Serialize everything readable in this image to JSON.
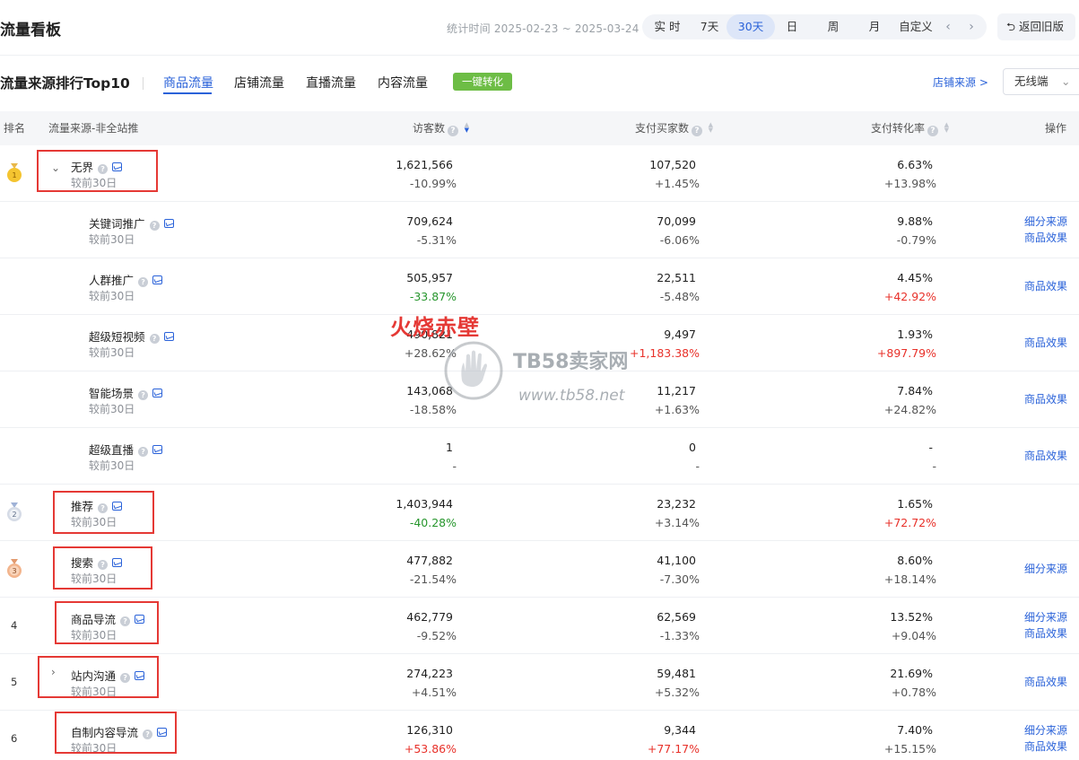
{
  "header": {
    "title": "流量看板",
    "stat_time": "统计时间 2025-02-23 ~ 2025-03-24",
    "periods": [
      "实 时",
      "7天",
      "30天",
      "日",
      "周",
      "月",
      "自定义"
    ],
    "active_period": "30天",
    "back_button": "返回旧版"
  },
  "section": {
    "title": "流量来源排行Top10",
    "tabs": [
      "商品流量",
      "店铺流量",
      "直播流量",
      "内容流量"
    ],
    "active_tab": "商品流量",
    "convert_button": "一键转化",
    "shop_source_link": "店铺来源 >",
    "device_select": "无线端"
  },
  "table": {
    "columns": {
      "rank": "排名",
      "source": "流量来源-非全站推",
      "visitors": "访客数",
      "buyers": "支付买家数",
      "conversion": "支付转化率",
      "action": "操作"
    },
    "compare_label": "较前30日",
    "rows": [
      {
        "rank": "1",
        "name": "无界",
        "visitors": "1,621,566",
        "visitors_delta": "-10.99%",
        "buyers": "107,520",
        "buyers_delta": "+1.45%",
        "conv": "6.63%",
        "conv_delta": "+13.98%",
        "actions": []
      },
      {
        "rank": "",
        "name": "关键词推广",
        "visitors": "709,624",
        "visitors_delta": "-5.31%",
        "buyers": "70,099",
        "buyers_delta": "-6.06%",
        "conv": "9.88%",
        "conv_delta": "-0.79%",
        "actions": [
          "细分来源",
          "商品效果"
        ]
      },
      {
        "rank": "",
        "name": "人群推广",
        "visitors": "505,957",
        "visitors_delta": "-33.87%",
        "buyers": "22,511",
        "buyers_delta": "-5.48%",
        "conv": "4.45%",
        "conv_delta": "+42.92%",
        "actions": [
          "商品效果"
        ]
      },
      {
        "rank": "",
        "name": "超级短视频",
        "visitors": "490,821",
        "visitors_delta": "+28.62%",
        "buyers": "9,497",
        "buyers_delta": "+1,183.38%",
        "conv": "1.93%",
        "conv_delta": "+897.79%",
        "actions": [
          "商品效果"
        ]
      },
      {
        "rank": "",
        "name": "智能场景",
        "visitors": "143,068",
        "visitors_delta": "-18.58%",
        "buyers": "11,217",
        "buyers_delta": "+1.63%",
        "conv": "7.84%",
        "conv_delta": "+24.82%",
        "actions": [
          "商品效果"
        ]
      },
      {
        "rank": "",
        "name": "超级直播",
        "visitors": "1",
        "visitors_delta": "-",
        "buyers": "0",
        "buyers_delta": "-",
        "conv": "-",
        "conv_delta": "-",
        "actions": [
          "商品效果"
        ]
      },
      {
        "rank": "2",
        "name": "推荐",
        "visitors": "1,403,944",
        "visitors_delta": "-40.28%",
        "buyers": "23,232",
        "buyers_delta": "+3.14%",
        "conv": "1.65%",
        "conv_delta": "+72.72%",
        "actions": []
      },
      {
        "rank": "3",
        "name": "搜索",
        "visitors": "477,882",
        "visitors_delta": "-21.54%",
        "buyers": "41,100",
        "buyers_delta": "-7.30%",
        "conv": "8.60%",
        "conv_delta": "+18.14%",
        "actions": [
          "细分来源"
        ]
      },
      {
        "rank": "4",
        "name": "商品导流",
        "visitors": "462,779",
        "visitors_delta": "-9.52%",
        "buyers": "62,569",
        "buyers_delta": "-1.33%",
        "conv": "13.52%",
        "conv_delta": "+9.04%",
        "actions": [
          "细分来源",
          "商品效果"
        ]
      },
      {
        "rank": "5",
        "name": "站内沟通",
        "visitors": "274,223",
        "visitors_delta": "+4.51%",
        "buyers": "59,481",
        "buyers_delta": "+5.32%",
        "conv": "21.69%",
        "conv_delta": "+0.78%",
        "actions": [
          "商品效果"
        ]
      },
      {
        "rank": "6",
        "name": "自制内容导流",
        "visitors": "126,310",
        "visitors_delta": "+53.86%",
        "buyers": "9,344",
        "buyers_delta": "+77.17%",
        "conv": "7.40%",
        "conv_delta": "+15.15%",
        "actions": [
          "细分来源",
          "商品效果"
        ]
      }
    ]
  },
  "watermark": {
    "red_text": "火烧赤壁",
    "brand": "TB58卖家网",
    "url": "www.tb58.net"
  },
  "colors": {
    "accent": "#2a62d9",
    "up": "#e8312a",
    "down": "#27962d",
    "convert_button": "#6dbd45",
    "highlight_box": "#e53935"
  }
}
